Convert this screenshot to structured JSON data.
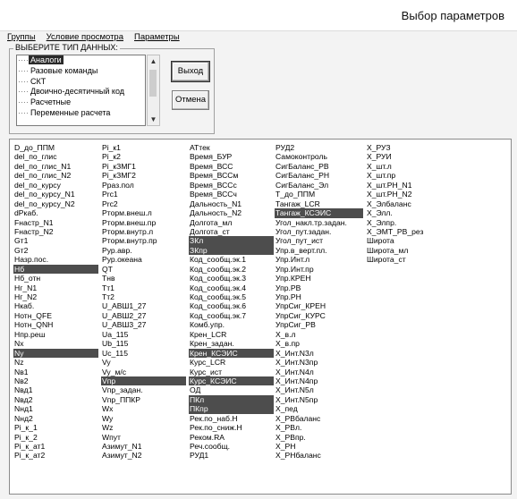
{
  "window": {
    "title": "Выбор параметров"
  },
  "menu": [
    {
      "label": "Группы"
    },
    {
      "label": "Условие просмотра"
    },
    {
      "label": "Параметры"
    }
  ],
  "type_group": {
    "legend": "ВЫБЕРИТЕ ТИП ДАННЫХ:",
    "items": [
      {
        "label": "Аналоги",
        "selected": true
      },
      {
        "label": "Разовые команды"
      },
      {
        "label": "СКТ"
      },
      {
        "label": "Двоично-десятичный код"
      },
      {
        "label": "Расчетные"
      },
      {
        "label": "Переменные расчета"
      }
    ]
  },
  "buttons": {
    "ok": "Выход",
    "cancel": "Отмена"
  },
  "parameters": {
    "columns": [
      [
        "D_до_ППМ",
        "del_по_глис",
        "del_по_глис_N1",
        "del_по_глис_N2",
        "del_по_курсу",
        "del_по_курсу_N1",
        "del_по_курсу_N2",
        "dPкаб.",
        "Fнастр_N1",
        "Fнастр_N2",
        "Gт1",
        "Gт2",
        "Hазр.пос.",
        "Hб",
        "Hб_отн",
        "Hг_N1",
        "Hг_N2",
        "Hкаб.",
        "Hотн_QFE",
        "Hотн_QNH",
        "Hпр.реш",
        "Nx",
        "Ny",
        "Nz",
        "Nв1",
        "Nв2",
        "Nвд1",
        "Nвд2",
        "Nнд1",
        "Nнд2",
        "Pi_к_1",
        "Pi_к_2",
        "Pi_к_ат1",
        "Pi_к_ат2"
      ],
      [
        "Pi_к1",
        "Pi_к2",
        "Pi_кЗМГ1",
        "Pi_кЗМГ2",
        "Pраз.пол",
        "Prc1",
        "Prc2",
        "Pторм.внеш.л",
        "Pторм.внеш.пр",
        "Pторм.внутр.л",
        "Pторм.внутр.пр",
        "Pур.авр.",
        "Pур.океана",
        "QT",
        "Tнв",
        "Tт1",
        "Tт2",
        "U_АВШ1_27",
        "U_АВШ2_27",
        "U_АВШ3_27",
        "Ua_115",
        "Ub_115",
        "Uc_115",
        "Vy",
        "Vy_м/с",
        "Vпр",
        "Vпр_задан.",
        "Vпр_ППКР",
        "Wx",
        "Wy",
        "Wz",
        "Wпут",
        "Азимут_N1",
        "Азимут_N2"
      ],
      [
        "АТтек",
        "Время_БУР",
        "Время_ВСС",
        "Время_ВССм",
        "Время_ВССс",
        "Время_ВССч",
        "Дальность_N1",
        "Дальность_N2",
        "Долгота_мл",
        "Долгота_ст",
        "ЗКл",
        "ЗКпр",
        "Код_сообщ.эк.1",
        "Код_сообщ.эк.2",
        "Код_сообщ.эк.3",
        "Код_сообщ.эк.4",
        "Код_сообщ.эк.5",
        "Код_сообщ.эк.6",
        "Код_сообщ.эк.7",
        "Комб.упр.",
        "Крен_LCR",
        "Крен_задан.",
        "Крен_КСЭИС",
        "Курс_LCR",
        "Курс_ист",
        "Курс_КСЭИС",
        "ОД",
        "ПКл",
        "ПКпр",
        "Рек.по_наб.Н",
        "Рек.по_сниж.Н",
        "Реком.RA",
        "Реч.сообщ.",
        "РУД1"
      ],
      [
        "РУД2",
        "Самоконтроль",
        "СигБаланс_РВ",
        "СигБаланс_РН",
        "СигБаланс_Эл",
        "Т_до_ППМ",
        "Тангаж_LCR",
        "Тангаж_КСЭИС",
        "Угол_накл.тр.задан.",
        "Угол_пут.задан.",
        "Угол_пут_ист",
        "Упр.в_верт.пл.",
        "Упр.Инт.л",
        "Упр.Инт.пр",
        "Упр.КРЕН",
        "Упр.РВ",
        "Упр.РН",
        "УпрСиг_КРЕН",
        "УпрСиг_КУРС",
        "УпрСиг_РВ",
        "Х_в.л",
        "Х_в.пр",
        "Х_Инт.N3л",
        "Х_Инт.N3пр",
        "Х_Инт.N4л",
        "Х_Инт.N4пр",
        "Х_Инт.N5л",
        "Х_Инт.N5пр",
        "Х_пед",
        "Х_РВбаланс",
        "Х_РВл.",
        "Х_РВпр.",
        "Х_РН",
        "Х_РНбаланс"
      ],
      [
        "Х_РУЗ",
        "Х_РУИ",
        "Х_шт.л",
        "Х_шт.пр",
        "Х_шт.РН_N1",
        "Х_шт.РН_N2",
        "Х_Элбаланс",
        "Х_Элл.",
        "Х_Элпр.",
        "Х_ЭМТ_РВ_рез",
        "Широта",
        "Широта_мл",
        "Широта_ст"
      ]
    ],
    "selected": [
      "Hб",
      "Ny",
      "Vпр",
      "ЗКл",
      "ЗКпр",
      "Крен_КСЭИС",
      "Курс_КСЭИС",
      "ПКл",
      "ПКпр",
      "Тангаж_КСЭИС"
    ]
  }
}
